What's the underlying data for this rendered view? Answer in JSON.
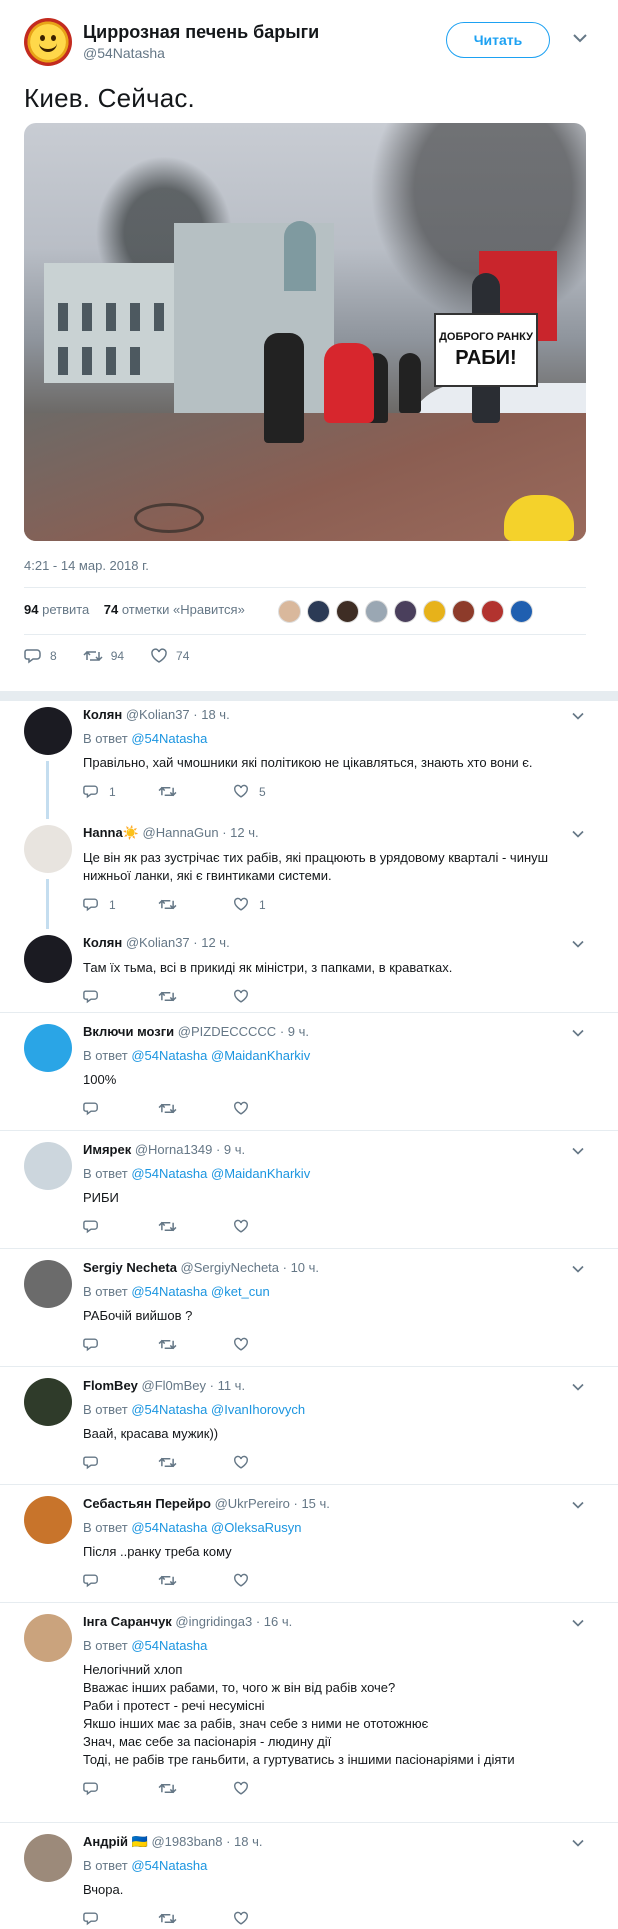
{
  "header": {
    "name": "Циррозная печень барыги",
    "handle": "@54Natasha",
    "follow_label": "Читать"
  },
  "tweet": {
    "text": "Киев. Сейчас.",
    "photo_sign_line1": "ДОБРОГО РАНКУ",
    "photo_sign_line2": "РАБИ!",
    "timestamp": "4:21 - 14 мар. 2018 г.",
    "retweets_count": "94",
    "retweets_label": "ретвита",
    "likes_count": "74",
    "likes_label": "отметки «Нравится»",
    "actions": {
      "reply": "8",
      "retweet": "94",
      "like": "74"
    }
  },
  "replies": [
    {
      "name": "Колян",
      "handle": "@Kolian37",
      "time": "· 18 ч.",
      "reply_to": [
        "@54Natasha"
      ],
      "lines": [
        "Правільно, хай чмошники які політикою не цікавляться, знають хто вони є."
      ],
      "reply_count": "1",
      "like_count": "5"
    },
    {
      "name": "Hanna☀️",
      "handle": "@HannaGun",
      "time": "· 12 ч.",
      "reply_to": [],
      "lines": [
        "Це він як раз зустрічає тих рабів, які працюють в урядовому кварталі - чинуш",
        "нижньої ланки, які є гвинтиками системи."
      ],
      "reply_count": "1",
      "like_count": "1"
    },
    {
      "name": "Колян",
      "handle": "@Kolian37",
      "time": "· 12 ч.",
      "reply_to": [],
      "lines": [
        "Там їх тьма, всі в прикиді як міністри, з папками, в краватках."
      ],
      "reply_count": "",
      "like_count": ""
    },
    {
      "name": "Включи мозги",
      "handle": "@PIZDECCCCC",
      "time": "· 9 ч.",
      "reply_to": [
        "@54Natasha",
        "@MaidanKharkiv"
      ],
      "lines": [
        "100%"
      ],
      "reply_count": "",
      "like_count": ""
    },
    {
      "name": "Имярек",
      "handle": "@Horna1349",
      "time": "· 9 ч.",
      "reply_to": [
        "@54Natasha",
        "@MaidanKharkiv"
      ],
      "lines": [
        "РИБИ"
      ],
      "reply_count": "",
      "like_count": ""
    },
    {
      "name": "Sergiy Necheta",
      "handle": "@SergiyNecheta",
      "time": "· 10 ч.",
      "reply_to": [
        "@54Natasha",
        "@ket_cun"
      ],
      "lines": [
        "РАБочій вийшов ?"
      ],
      "reply_count": "",
      "like_count": ""
    },
    {
      "name": "FlomBey",
      "handle": "@Fl0mBey",
      "time": "· 11 ч.",
      "reply_to": [
        "@54Natasha",
        "@IvanIhorovych"
      ],
      "lines": [
        "Ваай, красава мужик))"
      ],
      "reply_count": "",
      "like_count": ""
    },
    {
      "name": "Себастьян Перейро",
      "handle": "@UkrPereiro",
      "time": "· 15 ч.",
      "reply_to": [
        "@54Natasha",
        "@OleksaRusyn"
      ],
      "lines": [
        "Після ..ранку треба кому"
      ],
      "reply_count": "",
      "like_count": ""
    },
    {
      "name": "Інга Саранчук",
      "handle": "@ingridinga3",
      "time": "· 16 ч.",
      "reply_to": [
        "@54Natasha"
      ],
      "lines": [
        "Нелогічний хлоп",
        "Вважає інших рабами, то, чого ж він від рабів хоче?",
        "Раби і протест - речі несумісні",
        "Якшо інших має за рабів, знач себе з ними не ототожнює",
        "Знач, має себе за пасіонарія - людину дії",
        "Тоді, не рабів тре ганьбити, а гуртуватись з іншими пасіонаріями і діяти"
      ],
      "reply_count": "",
      "like_count": ""
    },
    {
      "name": "Андрій 🇺🇦",
      "handle": "@1983ban8",
      "time": "· 18 ч.",
      "reply_to": [
        "@54Natasha"
      ],
      "lines": [
        "Вчора."
      ],
      "reply_count": "",
      "like_count": ""
    }
  ],
  "reply_to_prefix": "В ответ",
  "colors": {
    "accent": "#1da1f2",
    "link": "#1b95e0",
    "muted": "#657786",
    "thread": "#c4ddef"
  }
}
